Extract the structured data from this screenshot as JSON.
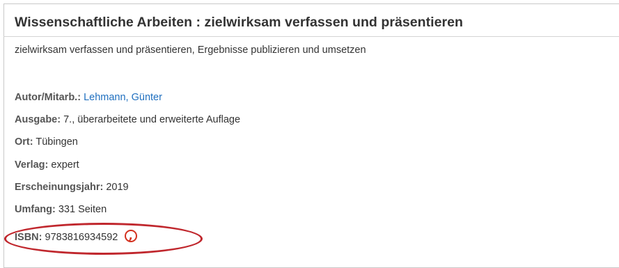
{
  "record": {
    "title": "Wissenschaftliche Arbeiten :  zielwirksam verfassen und präsentieren",
    "subtitle": "zielwirksam verfassen und präsentieren, Ergebnisse publizieren und umsetzen",
    "fields": {
      "autor": {
        "label": "Autor/Mitarb.:",
        "value": "Lehmann, Günter"
      },
      "ausgabe": {
        "label": "Ausgabe:",
        "value": "7., überarbeitete und erweiterte Auflage"
      },
      "ort": {
        "label": "Ort:",
        "value": "Tübingen"
      },
      "verlag": {
        "label": "Verlag:",
        "value": "expert"
      },
      "jahr": {
        "label": "Erscheinungsjahr:",
        "value": "2019"
      },
      "umfang": {
        "label": "Umfang:",
        "value": "331 Seiten"
      },
      "isbn": {
        "label": "ISBN:",
        "value": "9783816934592"
      }
    }
  },
  "icons": {
    "isbn_link_icon": "coins-icon"
  },
  "colors": {
    "link": "#1f6fbf",
    "highlight_ellipse": "#c0272d",
    "icon": "#d3301e"
  }
}
